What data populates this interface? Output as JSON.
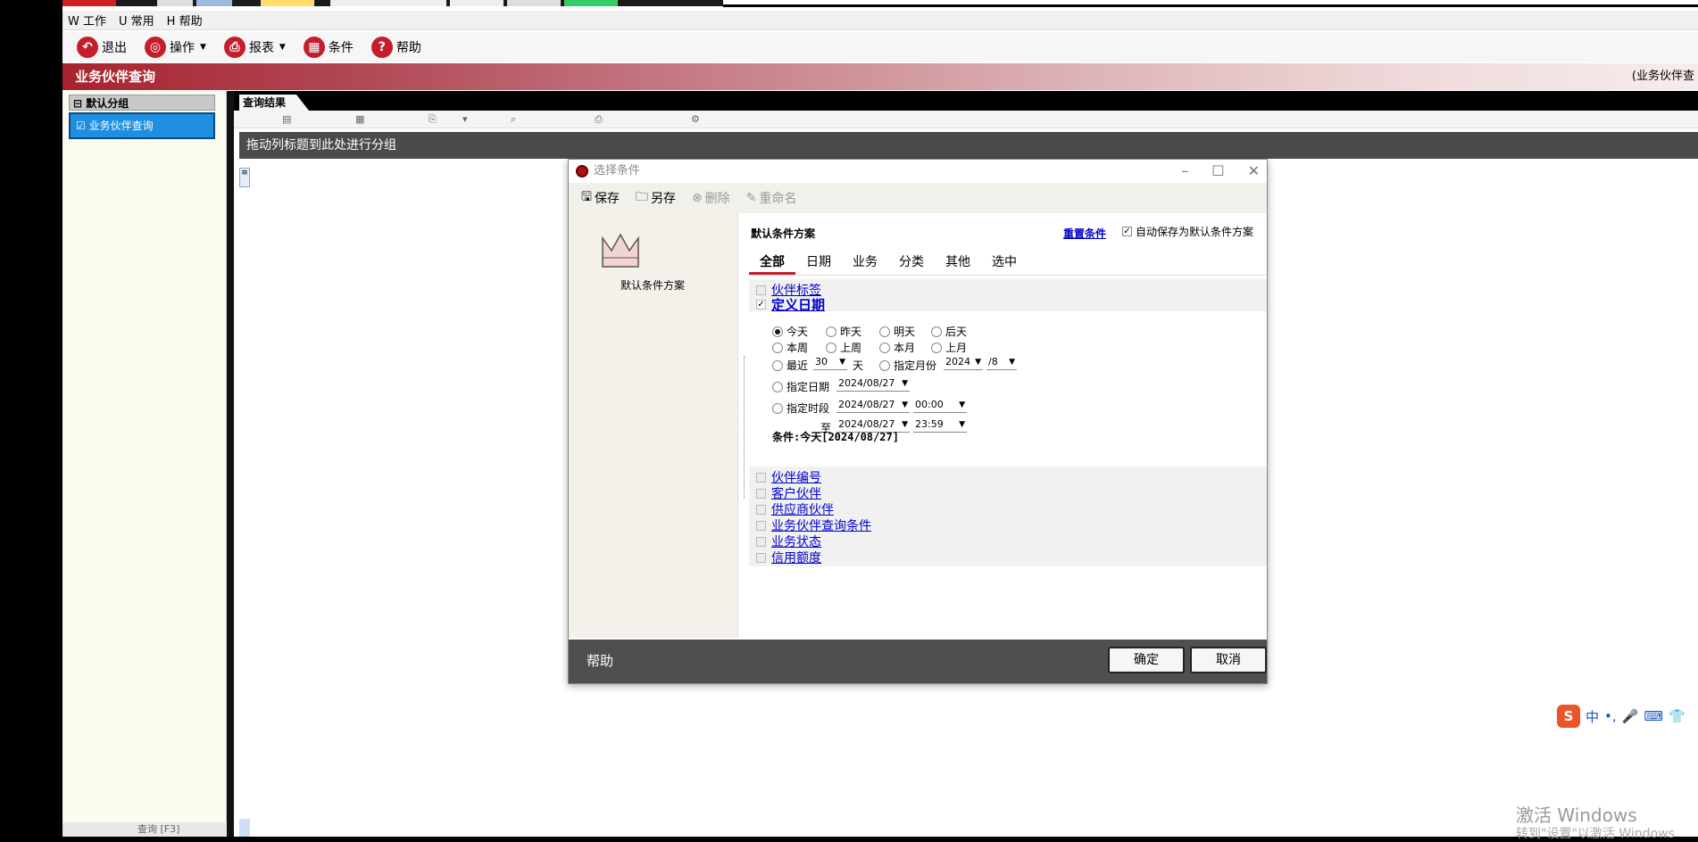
{
  "menu": {
    "items": [
      "W 工作",
      "U 常用",
      "H 帮助"
    ]
  },
  "toolbar": {
    "exit": "退出",
    "operate": "操作",
    "report": "报表",
    "condition": "条件",
    "help": "帮助"
  },
  "page": {
    "title": "业务伙伴查询",
    "title_right": "(业务伙伴查"
  },
  "left": {
    "group": "默认分组",
    "item": "业务伙伴查询",
    "bottom": "查询 [F3]"
  },
  "results": {
    "tab": "查询结果",
    "group_hint": "拖动列标题到此处进行分组"
  },
  "dialog": {
    "title": "选择条件",
    "tools": {
      "save": "保存",
      "save_as": "另存",
      "delete": "删除",
      "rename": "重命名"
    },
    "plan_label": "默认条件方案",
    "plan_title": "默认条件方案",
    "reset": "重置条件",
    "autosave": "自动保存为默认条件方案",
    "tabs": [
      "全部",
      "日期",
      "业务",
      "分类",
      "其他",
      "选中"
    ],
    "conditions_top": [
      "伙伴标签",
      "定义日期"
    ],
    "date": {
      "today": "今天",
      "yesterday": "昨天",
      "tomorrow": "明天",
      "day_after": "后天",
      "this_week": "本周",
      "last_week": "上周",
      "this_month": "本月",
      "last_month": "上月",
      "recent": "最近",
      "recent_days": "30",
      "day_unit": "天",
      "month_label": "指定月份",
      "year": "2024",
      "month": "/8",
      "date_label": "指定日期",
      "date_value": "2024/08/27",
      "period_label": "指定时段",
      "from_date": "2024/08/27",
      "from_time": "00:00",
      "to": "至",
      "to_date": "2024/08/27",
      "to_time": "23:59",
      "condition_text": "条件:今天[2024/08/27]"
    },
    "conditions_bottom": [
      "伙伴编号",
      "客户伙伴",
      "供应商伙伴",
      "业务伙伴查询条件",
      "业务状态",
      "信用额度"
    ],
    "help": "帮助",
    "ok": "确定",
    "cancel": "取消"
  },
  "ime": {
    "s": "S",
    "cn": "中"
  },
  "watermark": {
    "line1": "激活 Windows",
    "line2": "转到\"设置\"以激活 Windows"
  }
}
